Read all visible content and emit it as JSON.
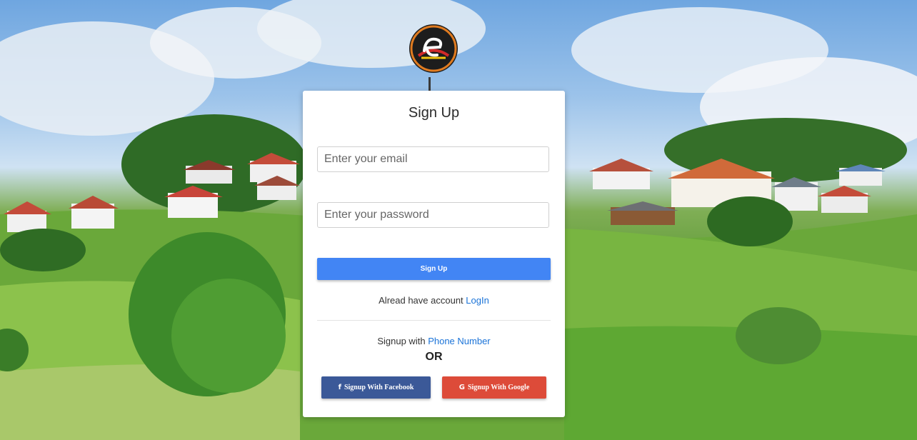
{
  "colors": {
    "primary": "#4285f4",
    "facebook": "#3b5998",
    "google": "#dd4b39",
    "link": "#1a73d8"
  },
  "form": {
    "title": "Sign Up",
    "email_placeholder": "Enter your email",
    "password_placeholder": "Enter your password",
    "submit_label": "Sign Up"
  },
  "login": {
    "prompt": "Alread have account",
    "link_label": "LogIn"
  },
  "alt_signup": {
    "prefix": "Signup with",
    "phone_link": "Phone Number",
    "or_label": "OR",
    "facebook_label": "Signup With Facebook",
    "google_label": "Signup With Google",
    "facebook_icon": "facebook-icon",
    "google_icon": "google-icon"
  }
}
